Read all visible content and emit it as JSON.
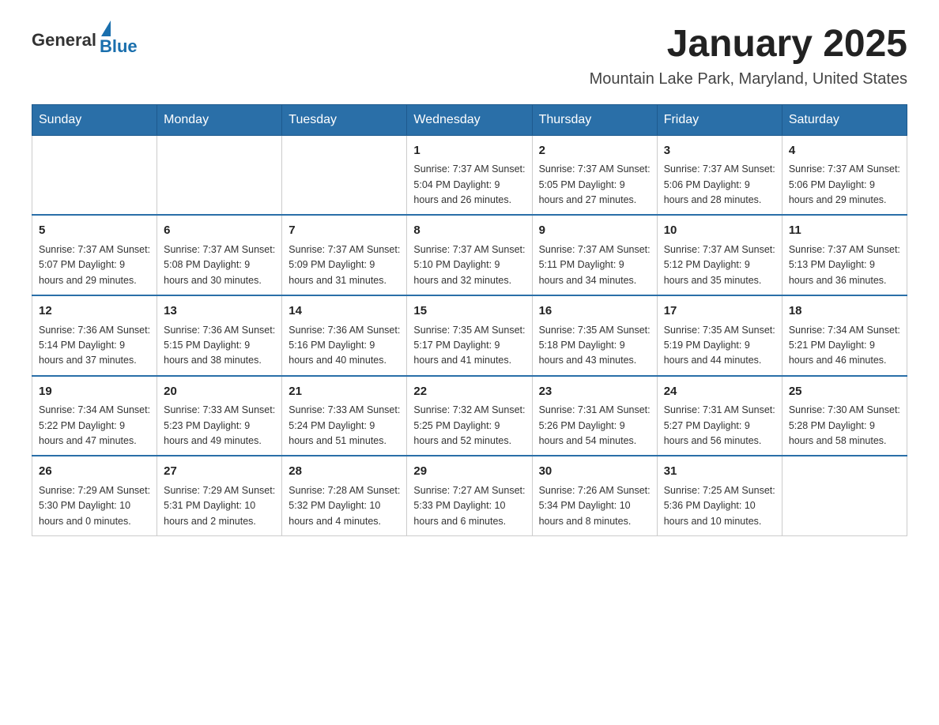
{
  "header": {
    "logo_general": "General",
    "logo_blue": "Blue",
    "title": "January 2025",
    "subtitle": "Mountain Lake Park, Maryland, United States"
  },
  "calendar": {
    "days_of_week": [
      "Sunday",
      "Monday",
      "Tuesday",
      "Wednesday",
      "Thursday",
      "Friday",
      "Saturday"
    ],
    "weeks": [
      [
        {
          "day": "",
          "info": ""
        },
        {
          "day": "",
          "info": ""
        },
        {
          "day": "",
          "info": ""
        },
        {
          "day": "1",
          "info": "Sunrise: 7:37 AM\nSunset: 5:04 PM\nDaylight: 9 hours\nand 26 minutes."
        },
        {
          "day": "2",
          "info": "Sunrise: 7:37 AM\nSunset: 5:05 PM\nDaylight: 9 hours\nand 27 minutes."
        },
        {
          "day": "3",
          "info": "Sunrise: 7:37 AM\nSunset: 5:06 PM\nDaylight: 9 hours\nand 28 minutes."
        },
        {
          "day": "4",
          "info": "Sunrise: 7:37 AM\nSunset: 5:06 PM\nDaylight: 9 hours\nand 29 minutes."
        }
      ],
      [
        {
          "day": "5",
          "info": "Sunrise: 7:37 AM\nSunset: 5:07 PM\nDaylight: 9 hours\nand 29 minutes."
        },
        {
          "day": "6",
          "info": "Sunrise: 7:37 AM\nSunset: 5:08 PM\nDaylight: 9 hours\nand 30 minutes."
        },
        {
          "day": "7",
          "info": "Sunrise: 7:37 AM\nSunset: 5:09 PM\nDaylight: 9 hours\nand 31 minutes."
        },
        {
          "day": "8",
          "info": "Sunrise: 7:37 AM\nSunset: 5:10 PM\nDaylight: 9 hours\nand 32 minutes."
        },
        {
          "day": "9",
          "info": "Sunrise: 7:37 AM\nSunset: 5:11 PM\nDaylight: 9 hours\nand 34 minutes."
        },
        {
          "day": "10",
          "info": "Sunrise: 7:37 AM\nSunset: 5:12 PM\nDaylight: 9 hours\nand 35 minutes."
        },
        {
          "day": "11",
          "info": "Sunrise: 7:37 AM\nSunset: 5:13 PM\nDaylight: 9 hours\nand 36 minutes."
        }
      ],
      [
        {
          "day": "12",
          "info": "Sunrise: 7:36 AM\nSunset: 5:14 PM\nDaylight: 9 hours\nand 37 minutes."
        },
        {
          "day": "13",
          "info": "Sunrise: 7:36 AM\nSunset: 5:15 PM\nDaylight: 9 hours\nand 38 minutes."
        },
        {
          "day": "14",
          "info": "Sunrise: 7:36 AM\nSunset: 5:16 PM\nDaylight: 9 hours\nand 40 minutes."
        },
        {
          "day": "15",
          "info": "Sunrise: 7:35 AM\nSunset: 5:17 PM\nDaylight: 9 hours\nand 41 minutes."
        },
        {
          "day": "16",
          "info": "Sunrise: 7:35 AM\nSunset: 5:18 PM\nDaylight: 9 hours\nand 43 minutes."
        },
        {
          "day": "17",
          "info": "Sunrise: 7:35 AM\nSunset: 5:19 PM\nDaylight: 9 hours\nand 44 minutes."
        },
        {
          "day": "18",
          "info": "Sunrise: 7:34 AM\nSunset: 5:21 PM\nDaylight: 9 hours\nand 46 minutes."
        }
      ],
      [
        {
          "day": "19",
          "info": "Sunrise: 7:34 AM\nSunset: 5:22 PM\nDaylight: 9 hours\nand 47 minutes."
        },
        {
          "day": "20",
          "info": "Sunrise: 7:33 AM\nSunset: 5:23 PM\nDaylight: 9 hours\nand 49 minutes."
        },
        {
          "day": "21",
          "info": "Sunrise: 7:33 AM\nSunset: 5:24 PM\nDaylight: 9 hours\nand 51 minutes."
        },
        {
          "day": "22",
          "info": "Sunrise: 7:32 AM\nSunset: 5:25 PM\nDaylight: 9 hours\nand 52 minutes."
        },
        {
          "day": "23",
          "info": "Sunrise: 7:31 AM\nSunset: 5:26 PM\nDaylight: 9 hours\nand 54 minutes."
        },
        {
          "day": "24",
          "info": "Sunrise: 7:31 AM\nSunset: 5:27 PM\nDaylight: 9 hours\nand 56 minutes."
        },
        {
          "day": "25",
          "info": "Sunrise: 7:30 AM\nSunset: 5:28 PM\nDaylight: 9 hours\nand 58 minutes."
        }
      ],
      [
        {
          "day": "26",
          "info": "Sunrise: 7:29 AM\nSunset: 5:30 PM\nDaylight: 10 hours\nand 0 minutes."
        },
        {
          "day": "27",
          "info": "Sunrise: 7:29 AM\nSunset: 5:31 PM\nDaylight: 10 hours\nand 2 minutes."
        },
        {
          "day": "28",
          "info": "Sunrise: 7:28 AM\nSunset: 5:32 PM\nDaylight: 10 hours\nand 4 minutes."
        },
        {
          "day": "29",
          "info": "Sunrise: 7:27 AM\nSunset: 5:33 PM\nDaylight: 10 hours\nand 6 minutes."
        },
        {
          "day": "30",
          "info": "Sunrise: 7:26 AM\nSunset: 5:34 PM\nDaylight: 10 hours\nand 8 minutes."
        },
        {
          "day": "31",
          "info": "Sunrise: 7:25 AM\nSunset: 5:36 PM\nDaylight: 10 hours\nand 10 minutes."
        },
        {
          "day": "",
          "info": ""
        }
      ]
    ]
  }
}
